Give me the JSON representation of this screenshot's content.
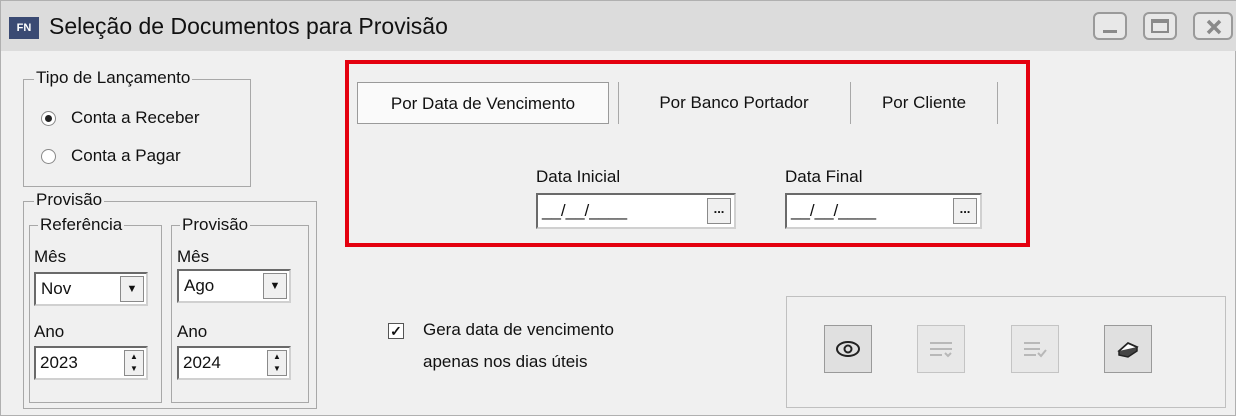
{
  "window": {
    "icon_label": "FN",
    "title": "Seleção de Documentos para Provisão",
    "controls": [
      "minimize-icon",
      "maximize-icon",
      "close-icon"
    ]
  },
  "tipo_lancamento": {
    "legend": "Tipo de Lançamento",
    "options": [
      {
        "label": "Conta a Receber",
        "selected": true
      },
      {
        "label": "Conta a Pagar",
        "selected": false
      }
    ]
  },
  "provisao": {
    "legend": "Provisão",
    "referencia": {
      "legend": "Referência",
      "mes_label": "Mês",
      "mes_value": "Nov",
      "ano_label": "Ano",
      "ano_value": "2023"
    },
    "provisao": {
      "legend": "Provisão",
      "mes_label": "Mês",
      "mes_value": "Ago",
      "ano_label": "Ano",
      "ano_value": "2024"
    }
  },
  "tabs": [
    {
      "label": "Por Data de Vencimento",
      "active": true
    },
    {
      "label": "Por Banco Portador",
      "active": false
    },
    {
      "label": "Por Cliente",
      "active": false
    }
  ],
  "dates": {
    "inicial_label": "Data Inicial",
    "inicial_value": "__/__/____",
    "final_label": "Data Final",
    "final_value": "__/__/____",
    "picker_label": "..."
  },
  "gera_data": {
    "checked": true,
    "line1": "Gera data de vencimento",
    "line2": "apenas nos dias úteis"
  },
  "toolbar": {
    "buttons": [
      "eye-icon",
      "list-down-icon",
      "list-check-icon",
      "eraser-icon"
    ]
  },
  "colors": {
    "highlight": "#e4000f",
    "window_bg": "#f0f0f0",
    "titlebar": "#dcdcdc"
  }
}
